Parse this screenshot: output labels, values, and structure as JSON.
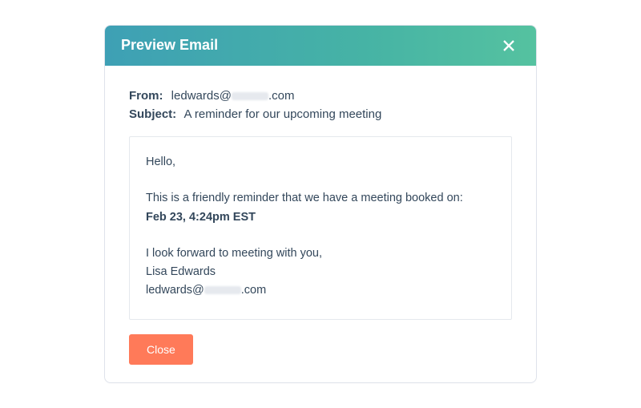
{
  "modal": {
    "title": "Preview Email",
    "close_btn_label": "Close"
  },
  "meta": {
    "from_label": "From:",
    "from_prefix": "ledwards@",
    "from_suffix": ".com",
    "subject_label": "Subject:",
    "subject_value": "A reminder for our upcoming meeting"
  },
  "email": {
    "greeting": "Hello,",
    "line1": "This is a friendly reminder that we have a meeting booked on:",
    "datetime": "Feb 23, 4:24pm EST",
    "closing": "I look forward to meeting with you,",
    "signature_name": "Lisa Edwards",
    "signature_email_prefix": "ledwards@",
    "signature_email_suffix": ".com"
  }
}
